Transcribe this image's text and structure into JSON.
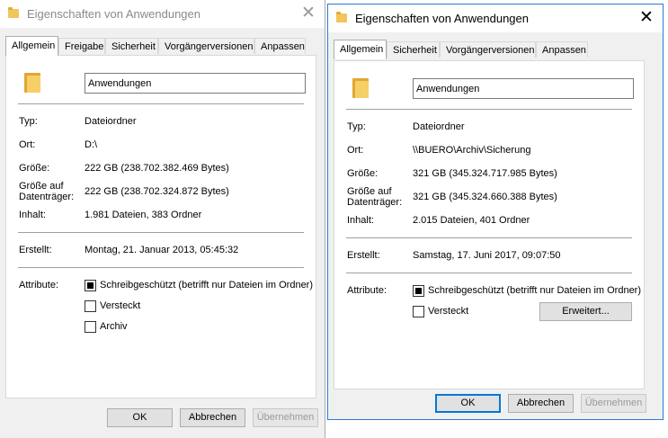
{
  "left_window": {
    "title": "Eigenschaften von Anwendungen",
    "tabs": [
      "Allgemein",
      "Freigabe",
      "Sicherheit",
      "Vorgängerversionen",
      "Anpassen"
    ],
    "active_tab": "Allgemein",
    "name": "Anwendungen",
    "labels": {
      "typ": "Typ:",
      "ort": "Ort:",
      "groesse": "Größe:",
      "groesse_auf_1": "Größe auf",
      "groesse_auf_2": "Datenträger:",
      "inhalt": "Inhalt:",
      "erstellt": "Erstellt:",
      "attribute": "Attribute:"
    },
    "typ": "Dateiordner",
    "ort": "D:\\",
    "groesse": "222 GB (238.702.382.469 Bytes)",
    "groesse_auf_datentraeger": "222 GB (238.702.324.872 Bytes)",
    "inhalt": "1.981 Dateien, 383 Ordner",
    "erstellt": "Montag, 21. Januar 2013, 05:45:32",
    "attributes": {
      "readonly": {
        "label": "Schreibgeschützt (betrifft nur Dateien im Ordner)",
        "checked": true
      },
      "hidden": {
        "label": "Versteckt",
        "checked": false
      },
      "archive": {
        "label": "Archiv",
        "checked": false
      }
    },
    "buttons": {
      "ok": "OK",
      "cancel": "Abbrechen",
      "apply": "Übernehmen"
    }
  },
  "right_window": {
    "title": "Eigenschaften von Anwendungen",
    "tabs": [
      "Allgemein",
      "Sicherheit",
      "Vorgängerversionen",
      "Anpassen"
    ],
    "active_tab": "Allgemein",
    "name": "Anwendungen",
    "labels": {
      "typ": "Typ:",
      "ort": "Ort:",
      "groesse": "Größe:",
      "groesse_auf_1": "Größe auf",
      "groesse_auf_2": "Datenträger:",
      "inhalt": "Inhalt:",
      "erstellt": "Erstellt:",
      "attribute": "Attribute:"
    },
    "typ": "Dateiordner",
    "ort": "\\\\BUERO\\Archiv\\Sicherung",
    "groesse": "321 GB (345.324.717.985 Bytes)",
    "groesse_auf_datentraeger": "321 GB (345.324.660.388 Bytes)",
    "inhalt": "2.015 Dateien, 401 Ordner",
    "erstellt": "Samstag, 17. Juni 2017, 09:07:50",
    "attributes": {
      "readonly": {
        "label": "Schreibgeschützt (betrifft nur Dateien im Ordner)",
        "checked": true
      },
      "hidden": {
        "label": "Versteckt",
        "checked": false
      }
    },
    "advanced_button": "Erweitert...",
    "buttons": {
      "ok": "OK",
      "cancel": "Abbrechen",
      "apply": "Übernehmen"
    }
  },
  "icons": {
    "title": "folder-icon",
    "close": "close-icon",
    "folder": "folder-icon",
    "checkbox": "checkbox-icon"
  },
  "colors": {
    "accent": "#0078d7",
    "window_border": "#2b79d8",
    "folder": "#f7cf68"
  }
}
